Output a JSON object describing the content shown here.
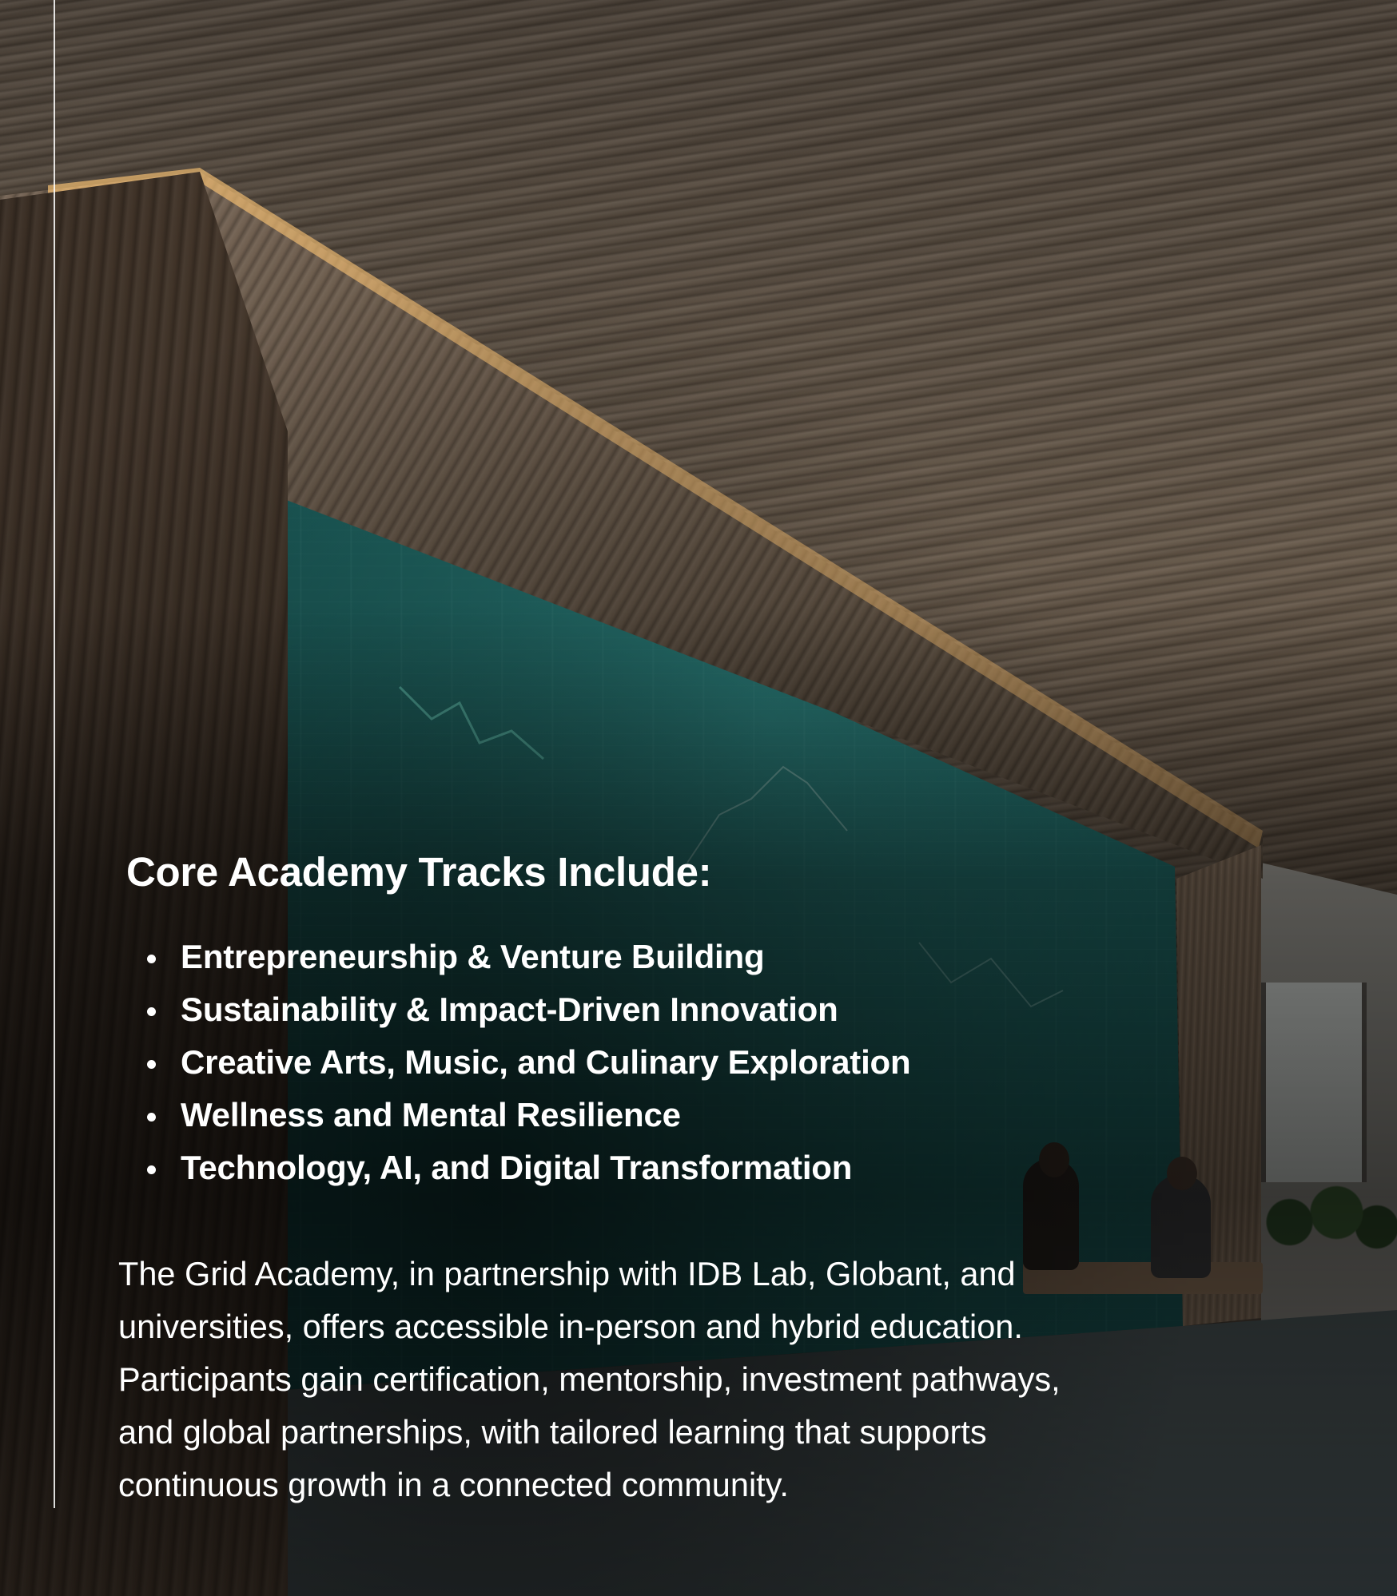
{
  "heading": "Core Academy Tracks Include:",
  "tracks": [
    "Entrepreneurship & Venture Building",
    "Sustainability & Impact-Driven Innovation",
    "Creative Arts, Music, and Culinary Exploration",
    "Wellness and Mental Resilience",
    "Technology, AI, and Digital Transformation"
  ],
  "description": {
    "lines": [
      "The Grid Academy, in partnership with IDB Lab, Globant, and",
      "universities, offers accessible in-person and hybrid education.",
      "Participants gain certification, mentorship, investment pathways,",
      "and global partnerships, with tailored learning that supports",
      "continuous growth in a connected community."
    ]
  },
  "colors": {
    "text": "#ffffff",
    "screen_teal": "#2f8a86",
    "wood": "#6b5c4c"
  }
}
